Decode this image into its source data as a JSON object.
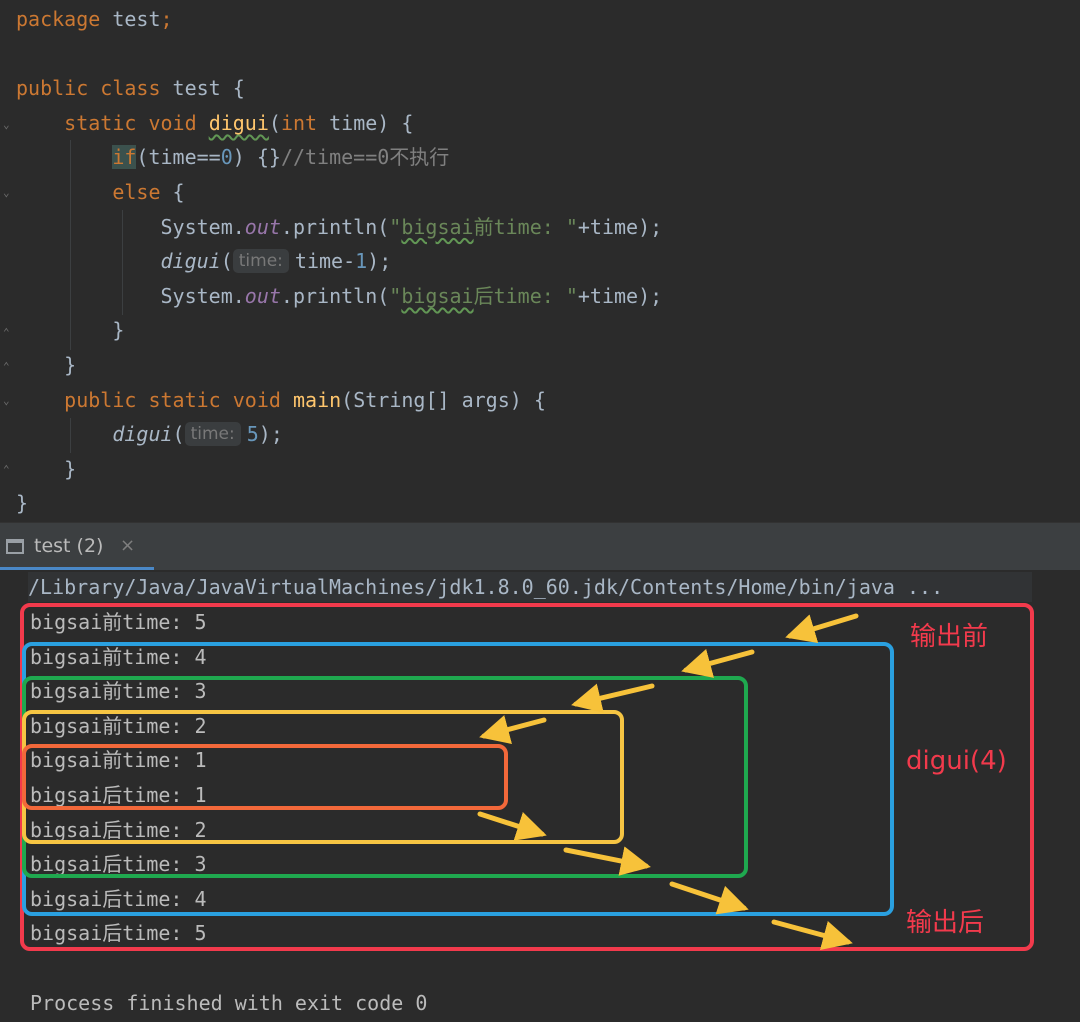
{
  "editor": {
    "lines": [
      [
        {
          "t": "package ",
          "c": "kw"
        },
        {
          "t": "test",
          "c": "plain"
        },
        {
          "t": ";",
          "c": "kw"
        }
      ],
      [],
      [
        {
          "t": "public ",
          "c": "kw"
        },
        {
          "t": "class ",
          "c": "kw"
        },
        {
          "t": "test {",
          "c": "plain"
        }
      ],
      [
        {
          "t": "    "
        },
        {
          "t": "static ",
          "c": "kw"
        },
        {
          "t": "void ",
          "c": "kw"
        },
        {
          "t": "digui",
          "c": "fn wavy"
        },
        {
          "t": "(",
          "c": "plain"
        },
        {
          "t": "int ",
          "c": "kw"
        },
        {
          "t": "time) {",
          "c": "plain"
        }
      ],
      [
        {
          "t": "        "
        },
        {
          "t": "if",
          "c": "kw hl"
        },
        {
          "t": "(time==",
          "c": "plain"
        },
        {
          "t": "0",
          "c": "num"
        },
        {
          "t": ") {}",
          "c": "plain"
        },
        {
          "t": "//time==0不执行",
          "c": "cmt"
        }
      ],
      [
        {
          "t": "        "
        },
        {
          "t": "else ",
          "c": "kw"
        },
        {
          "t": "{",
          "c": "plain"
        }
      ],
      [
        {
          "t": "            "
        },
        {
          "t": "System.",
          "c": "plain"
        },
        {
          "t": "out",
          "c": "fld"
        },
        {
          "t": ".println(",
          "c": "plain"
        },
        {
          "t": "\"",
          "c": "str"
        },
        {
          "t": "bigsai",
          "c": "str wavy"
        },
        {
          "t": "前time: \"",
          "c": "str"
        },
        {
          "t": "+time);",
          "c": "plain"
        }
      ],
      [
        {
          "t": "            "
        },
        {
          "t": "digui",
          "c": "plain it"
        },
        {
          "t": "(",
          "c": "plain"
        },
        {
          "t": "time:",
          "c": "hint"
        },
        {
          "t": "time-",
          "c": "plain"
        },
        {
          "t": "1",
          "c": "num"
        },
        {
          "t": ");",
          "c": "plain"
        }
      ],
      [
        {
          "t": "            "
        },
        {
          "t": "System.",
          "c": "plain"
        },
        {
          "t": "out",
          "c": "fld"
        },
        {
          "t": ".println(",
          "c": "plain"
        },
        {
          "t": "\"",
          "c": "str"
        },
        {
          "t": "bigsai",
          "c": "str wavy"
        },
        {
          "t": "后time: \"",
          "c": "str"
        },
        {
          "t": "+time);",
          "c": "plain"
        }
      ],
      [
        {
          "t": "        "
        },
        {
          "t": "}",
          "c": "plain"
        }
      ],
      [
        {
          "t": "    "
        },
        {
          "t": "}",
          "c": "plain"
        }
      ],
      [
        {
          "t": "    "
        },
        {
          "t": "public ",
          "c": "kw"
        },
        {
          "t": "static ",
          "c": "kw"
        },
        {
          "t": "void ",
          "c": "kw"
        },
        {
          "t": "main",
          "c": "fn"
        },
        {
          "t": "(String[] args) {",
          "c": "plain"
        }
      ],
      [
        {
          "t": "        "
        },
        {
          "t": "digui",
          "c": "plain it"
        },
        {
          "t": "(",
          "c": "plain"
        },
        {
          "t": "time:",
          "c": "hint"
        },
        {
          "t": "5",
          "c": "num"
        },
        {
          "t": ");",
          "c": "plain"
        }
      ],
      [
        {
          "t": "    "
        },
        {
          "t": "}",
          "c": "plain"
        }
      ],
      [
        {
          "t": "}",
          "c": "plain"
        }
      ]
    ]
  },
  "run_panel": {
    "tab_label": "test (2)",
    "close_glyph": "×",
    "command": "/Library/Java/JavaVirtualMachines/jdk1.8.0_60.jdk/Contents/Home/bin/java ...",
    "output": [
      "bigsai前time: 5",
      "bigsai前time: 4",
      "bigsai前time: 3",
      "bigsai前time: 2",
      "bigsai前time: 1",
      "bigsai后time: 1",
      "bigsai后time: 2",
      "bigsai后time: 3",
      "bigsai后time: 4",
      "bigsai后time: 5"
    ],
    "exit_message": "Process finished with exit code 0"
  },
  "annotations": {
    "label_before": "输出前",
    "label_digui": "digui(4)",
    "label_after": "输出后",
    "colors": {
      "red": "#f23a4c",
      "blue": "#2aa0e0",
      "green": "#1fa84f",
      "yellow": "#f6c543",
      "orange": "#f2683a",
      "arrow": "#f7c23a"
    }
  }
}
